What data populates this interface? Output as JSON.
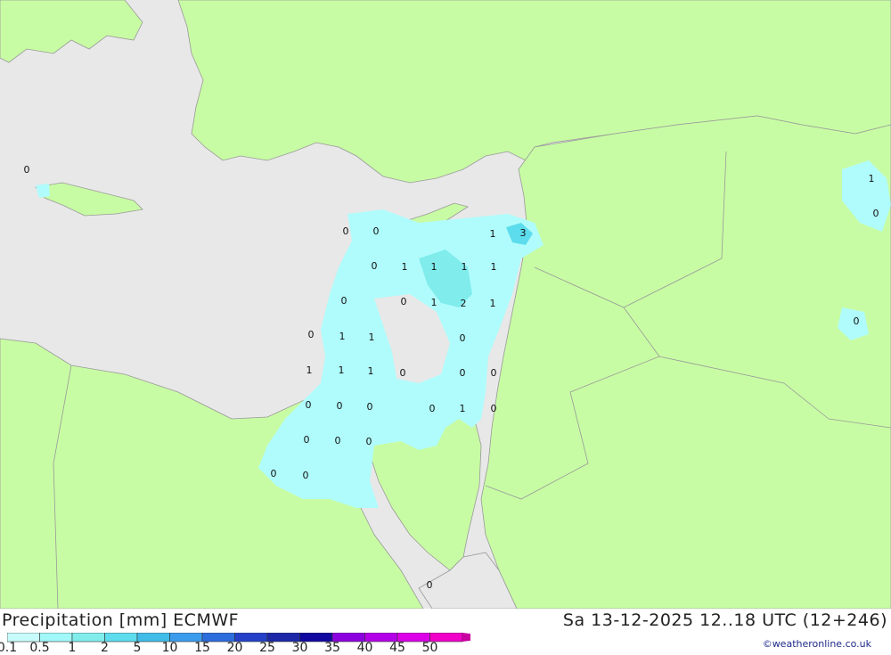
{
  "title": "Precipitation [mm] ECMWF",
  "datetime": "Sa 13-12-2025 12..18 UTC (12+246)",
  "credit": "©weatheronline.co.uk",
  "colors": {
    "land": "#c8fca4",
    "sea": "#e8e8e8",
    "border": "#999999",
    "precip_light": "#b0fcfc"
  },
  "legend": {
    "colors": [
      "#c8fcfc",
      "#a0f8f8",
      "#80ecec",
      "#5cdcec",
      "#40bce8",
      "#3c9cec",
      "#2c6cdc",
      "#2440c8",
      "#1c28a8",
      "#1008a0",
      "#8c00e0",
      "#b400e8",
      "#dc00e8",
      "#f000c8",
      "#c800a0"
    ],
    "labels": [
      "0.1",
      "0.5",
      "1",
      "2",
      "5",
      "10",
      "15",
      "20",
      "25",
      "30",
      "35",
      "40",
      "45",
      "50"
    ]
  },
  "values": [
    {
      "v": "0"
    },
    {
      "v": "0"
    },
    {
      "v": "0"
    },
    {
      "v": "1"
    },
    {
      "v": "3"
    },
    {
      "v": "0"
    },
    {
      "v": "1"
    },
    {
      "v": "1"
    },
    {
      "v": "1"
    },
    {
      "v": "1"
    },
    {
      "v": "0"
    },
    {
      "v": "0"
    },
    {
      "v": "1"
    },
    {
      "v": "2"
    },
    {
      "v": "1"
    },
    {
      "v": "0"
    },
    {
      "v": "1"
    },
    {
      "v": "1"
    },
    {
      "v": "0"
    },
    {
      "v": "1"
    },
    {
      "v": "1"
    },
    {
      "v": "1"
    },
    {
      "v": "0"
    },
    {
      "v": "0"
    },
    {
      "v": "0"
    },
    {
      "v": "0"
    },
    {
      "v": "0"
    },
    {
      "v": "0"
    },
    {
      "v": "0"
    },
    {
      "v": "1"
    },
    {
      "v": "0"
    },
    {
      "v": "0"
    },
    {
      "v": "0"
    },
    {
      "v": "0"
    },
    {
      "v": "0"
    },
    {
      "v": "0"
    },
    {
      "v": "0"
    },
    {
      "v": "1"
    },
    {
      "v": "0"
    },
    {
      "v": "0"
    }
  ]
}
